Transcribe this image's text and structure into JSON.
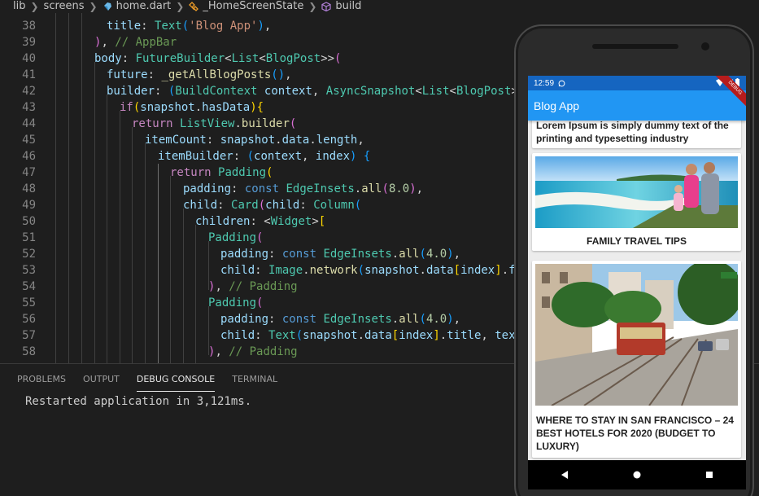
{
  "breadcrumb": {
    "items": [
      "lib",
      "screens",
      "home.dart",
      "_HomeScreenState",
      "build"
    ],
    "icons": [
      "none",
      "none",
      "dart-file-icon",
      "class-icon",
      "method-cube-icon"
    ]
  },
  "editor": {
    "line_numbers": [
      "38",
      "39",
      "40",
      "41",
      "42",
      "43",
      "44",
      "45",
      "46",
      "47",
      "48",
      "49",
      "50",
      "51",
      "52",
      "53",
      "54",
      "55",
      "56",
      "57",
      "58"
    ]
  },
  "panel": {
    "tabs": [
      "PROBLEMS",
      "OUTPUT",
      "DEBUG CONSOLE",
      "TERMINAL"
    ],
    "active_tab": "DEBUG CONSOLE",
    "console_output": "Restarted application in 3,121ms."
  },
  "phone": {
    "status_time": "12:59",
    "app_title": "Blog App",
    "debug_banner": "DEBUG",
    "posts": [
      {
        "title": "Lorem Ipsum is simply dummy text of the printing and typesetting industry"
      },
      {
        "title": "FAMILY TRAVEL TIPS"
      },
      {
        "title": "WHERE TO STAY IN SAN FRANCISCO – 24 BEST HOTELS FOR 2020 (BUDGET TO LUXURY)"
      }
    ],
    "nav_buttons": [
      "back-triangle-icon",
      "home-circle-icon",
      "recents-square-icon"
    ]
  },
  "colors": {
    "editor_bg": "#1e1e1e",
    "status_bar": "#1565c0",
    "app_bar": "#2196f3",
    "keyword": "#569cd6",
    "type": "#4ec9b0",
    "function": "#dcdcaa",
    "property": "#9cdcfe",
    "string": "#ce9178",
    "number": "#b5cea8",
    "comment": "#6a9955"
  }
}
